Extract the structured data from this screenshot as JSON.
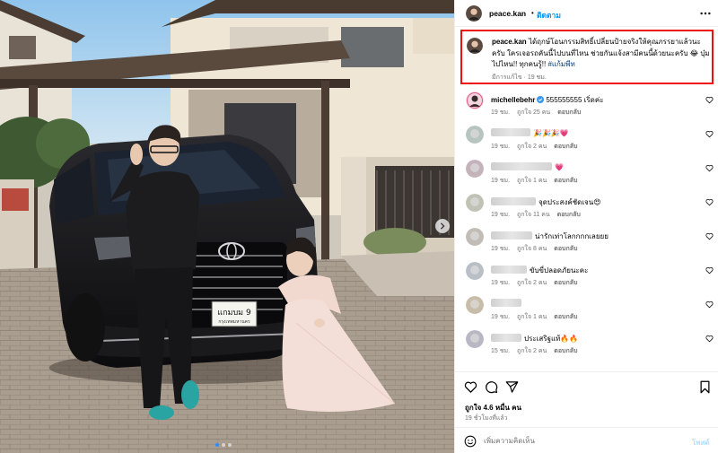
{
  "post": {
    "username": "peace.kan",
    "follow_label": "ติดตาม",
    "separator": "•",
    "caption_text": "ได้ฤกษ์โอนกรรมสิทธิ์เปลี่ยนป้ายจริงให้คุณภรรยาแล้วนะครับ ใครเจอรถคันนี้ไปบนที่ไหน ช่วยกันแจ้งสามีคนนี้ด้วยนะครับ 😂 บุ๋มไปไหน!! ทุกคนรู้!!",
    "caption_tag": "#แก้มพีท",
    "caption_meta": "มีการแก้ไข · 19 ชม.",
    "license_plate": "แกมบม 9",
    "plate_province": "กรุงเทพมหานคร",
    "carousel_dots": 3
  },
  "comments": [
    {
      "username": "michellebehr",
      "verified": true,
      "text": "555555555 เริ่ดค่ะ",
      "time": "19 ชม.",
      "likes": "ถูกใจ 25 คน",
      "reply": "ตอบกลับ",
      "blurred": false
    },
    {
      "username": "",
      "blur_width": 44,
      "text": "🎉🎉🎉💗",
      "time": "19 ชม.",
      "likes": "ถูกใจ 2 คน",
      "reply": "ตอบกลับ",
      "blurred": true
    },
    {
      "username": "",
      "blur_width": 68,
      "text": "💗",
      "time": "19 ชม.",
      "likes": "ถูกใจ 1 คน",
      "reply": "ตอบกลับ",
      "blurred": true
    },
    {
      "username": "",
      "blur_width": 50,
      "text": "จุดประสงค์ชัดเจน😍",
      "time": "19 ชม.",
      "likes": "ถูกใจ 11 คน",
      "reply": "ตอบกลับ",
      "blurred": true
    },
    {
      "username": "",
      "blur_width": 46,
      "text": "น่ารักเท่าโลกกกกเลยยย",
      "time": "19 ชม.",
      "likes": "ถูกใจ 8 คน",
      "reply": "ตอบกลับ",
      "blurred": true
    },
    {
      "username": "",
      "blur_width": 40,
      "text": "ขับขี่ปลอดภัยนะคะ",
      "time": "19 ชม.",
      "likes": "ถูกใจ 2 คน",
      "reply": "ตอบกลับ",
      "blurred": true
    },
    {
      "username": "",
      "blur_width": 34,
      "text": "",
      "time": "19 ชม.",
      "likes": "ถูกใจ 1 คน",
      "reply": "ตอบกลับ",
      "blurred": true
    },
    {
      "username": "",
      "blur_width": 34,
      "text": "ประเสริฐแท้🔥🔥",
      "time": "15 ชม.",
      "likes": "ถูกใจ 2 คน",
      "reply": "ตอบกลับ",
      "blurred": true
    }
  ],
  "footer": {
    "likes": "ถูกใจ 4.6 หมื่น คน",
    "time_ago": "19 ชั่วโมงที่แล้ว",
    "comment_placeholder": "เพิ่มความคิดเห็น",
    "post_label": "โพสต์"
  },
  "icons": [
    "more-icon",
    "heart-icon",
    "comment-icon",
    "share-icon",
    "bookmark-icon",
    "emoji-icon",
    "verified-icon",
    "chevron-right-icon"
  ],
  "colors": {
    "accent": "#0095f6",
    "highlight_border": "#ee1111",
    "verified": "#3897f0"
  }
}
